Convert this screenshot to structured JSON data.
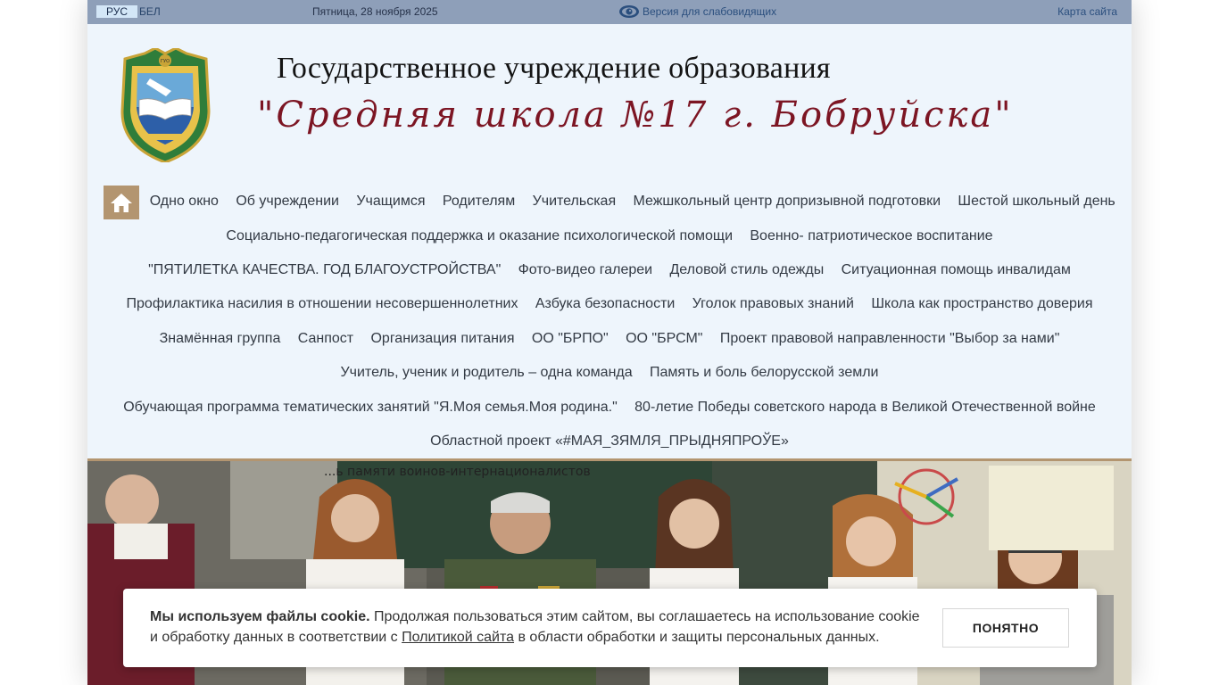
{
  "topbar": {
    "lang_rus": "РУС",
    "lang_bel": "БЕЛ",
    "date": "Пятница, 28 ноября 2025",
    "low_vision": "Версия для слабовидящих",
    "sitemap": "Карта сайта"
  },
  "header": {
    "title_line1": "Государственное учреждение образования",
    "title_line2": "\"Средняя школа №17 г. Бобруйска\"",
    "emblem_text": "ГУО"
  },
  "nav": {
    "row1": [
      "Одно окно",
      "Об учреждении",
      "Учащимся",
      "Родителям",
      "Учительская",
      "Межшкольный центр допризывной подготовки",
      "Шестой школьный день"
    ],
    "row2": [
      "Социально-педагогическая поддержка и оказание психологической помощи",
      "Военно- патриотическое воспитание"
    ],
    "row3": [
      "\"ПЯТИЛЕТКА КАЧЕСТВА. ГОД БЛАГОУСТРОЙСТВА\"",
      "Фото-видео галереи",
      "Деловой стиль одежды",
      "Ситуационная помощь инвалидам"
    ],
    "row4": [
      "Профилактика насилия в отношении несовершеннолетних",
      "Азбука безопасности",
      "Уголок правовых знаний",
      "Школа как пространство доверия"
    ],
    "row5": [
      "Знамённая группа",
      "Санпост",
      "Организация питания",
      "ОО \"БРПО\"",
      "ОО \"БРСМ\"",
      "Проект правовой направленности \"Выбор за нами\""
    ],
    "row6": [
      "Учитель, ученик и родитель – одна команда",
      "Память и боль белорусской земли"
    ],
    "row7": [
      "Обучающая программа тематических занятий \"Я.Моя семья.Моя родина.\"",
      "80-летие Победы советского народа в Великой Отечественной войне"
    ],
    "row8": [
      "Областной проект «#МАЯ_ЗЯМЛЯ_ПРЫДНЯПРОЎЕ»"
    ]
  },
  "banner": {
    "poster_text": "...ь памяти воинов-интернационалистов"
  },
  "cookie": {
    "bold": "Мы используем файлы cookie.",
    "text1": " Продолжая пользоваться этим сайтом, вы соглашаетесь на использование cookie и обработку данных в соответствии с ",
    "link": "Политикой сайта",
    "text2": " в области обработки и защиты персональных данных.",
    "button": "ПОНЯТНО"
  },
  "colors": {
    "topbar": "#8e9fb9",
    "page_bg": "#eef5fc",
    "accent": "#b39570",
    "title_red": "#7c1523"
  }
}
